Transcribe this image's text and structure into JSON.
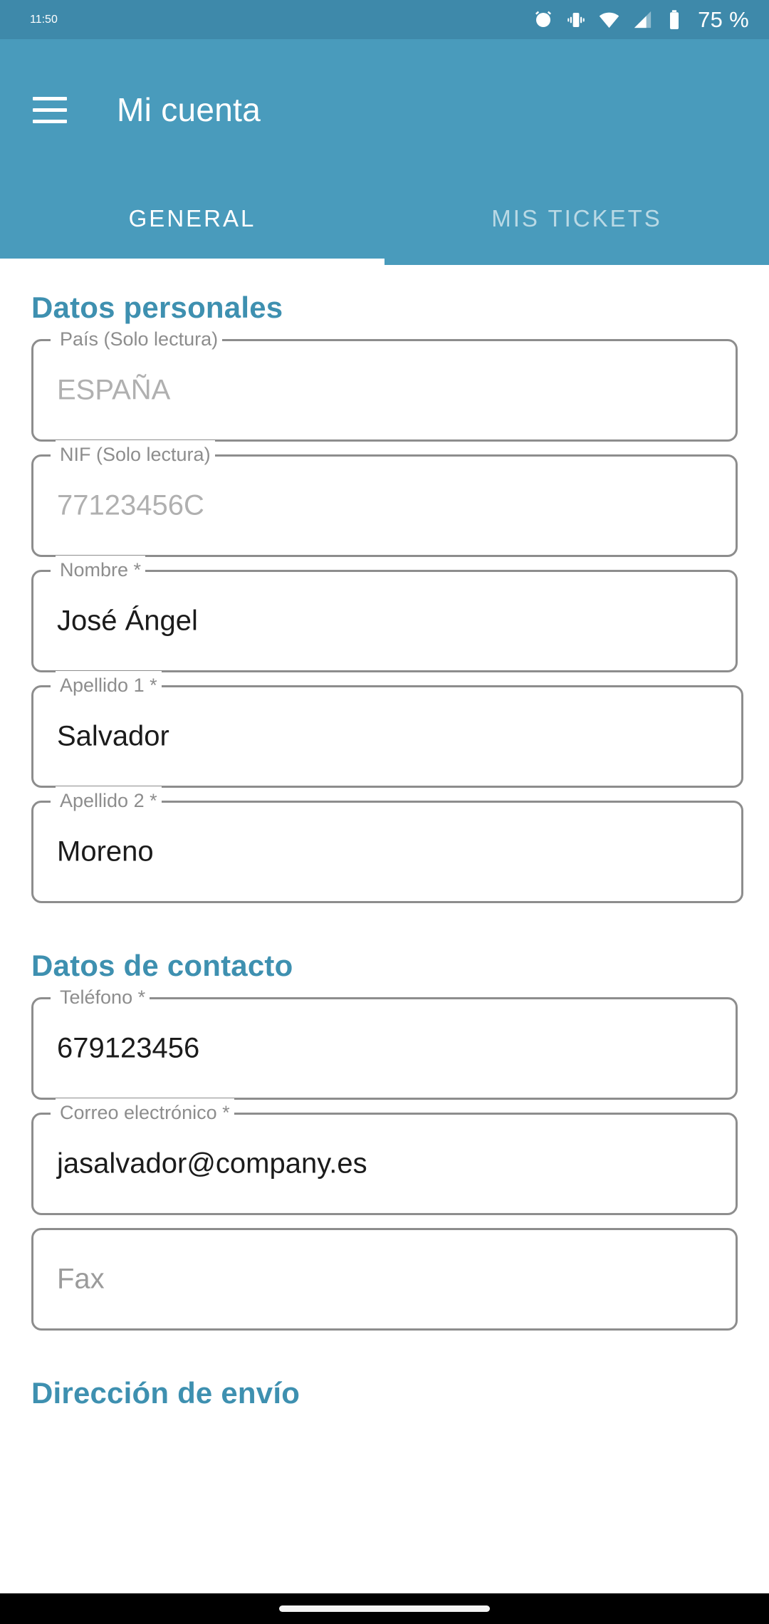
{
  "status_bar": {
    "time": "11:50",
    "battery_text": "75 %",
    "icons": [
      "alarm-icon",
      "vibrate-icon",
      "wifi-icon",
      "signal-icon",
      "battery-icon"
    ],
    "background_color": "#3e89aa"
  },
  "app_bar": {
    "menu_icon": "hamburger-menu-icon",
    "title": "Mi cuenta",
    "background_color": "#499bbc"
  },
  "tabs": {
    "items": [
      {
        "label": "GENERAL",
        "active": true
      },
      {
        "label": "MIS TICKETS",
        "active": false
      }
    ],
    "indicator_color": "#ffffff"
  },
  "sections": [
    {
      "title": "Datos personales",
      "fields": [
        {
          "label": "País (Solo lectura)",
          "value": "ESPAÑA",
          "readonly": true,
          "required": false
        },
        {
          "label": "NIF (Solo lectura)",
          "value": "77123456C",
          "readonly": true,
          "required": false
        },
        {
          "label": "Nombre *",
          "value": "José Ángel",
          "readonly": false,
          "required": true
        },
        {
          "label": "Apellido 1 *",
          "value": "Salvador",
          "readonly": false,
          "required": true
        },
        {
          "label": "Apellido 2 *",
          "value": "Moreno",
          "readonly": false,
          "required": true
        }
      ]
    },
    {
      "title": "Datos de contacto",
      "fields": [
        {
          "label": "Teléfono *",
          "value": "679123456",
          "readonly": false,
          "required": true
        },
        {
          "label": "Correo electrónico *",
          "value": "jasalvador@company.es",
          "readonly": false,
          "required": true
        },
        {
          "label": "",
          "value": "",
          "placeholder": "Fax",
          "readonly": false,
          "required": false
        }
      ]
    },
    {
      "title": "Dirección de envío",
      "fields": []
    }
  ],
  "theme": {
    "accent": "#3e90b0",
    "app_bar": "#499bbc",
    "status_bar": "#3e89aa",
    "field_border": "#8d8d8d",
    "label_text": "#8d8d8d",
    "value_text": "#1b1b1b",
    "readonly_text": "#b0b0b0"
  },
  "nav_bar": {
    "gesture_pill": "home-indicator"
  }
}
